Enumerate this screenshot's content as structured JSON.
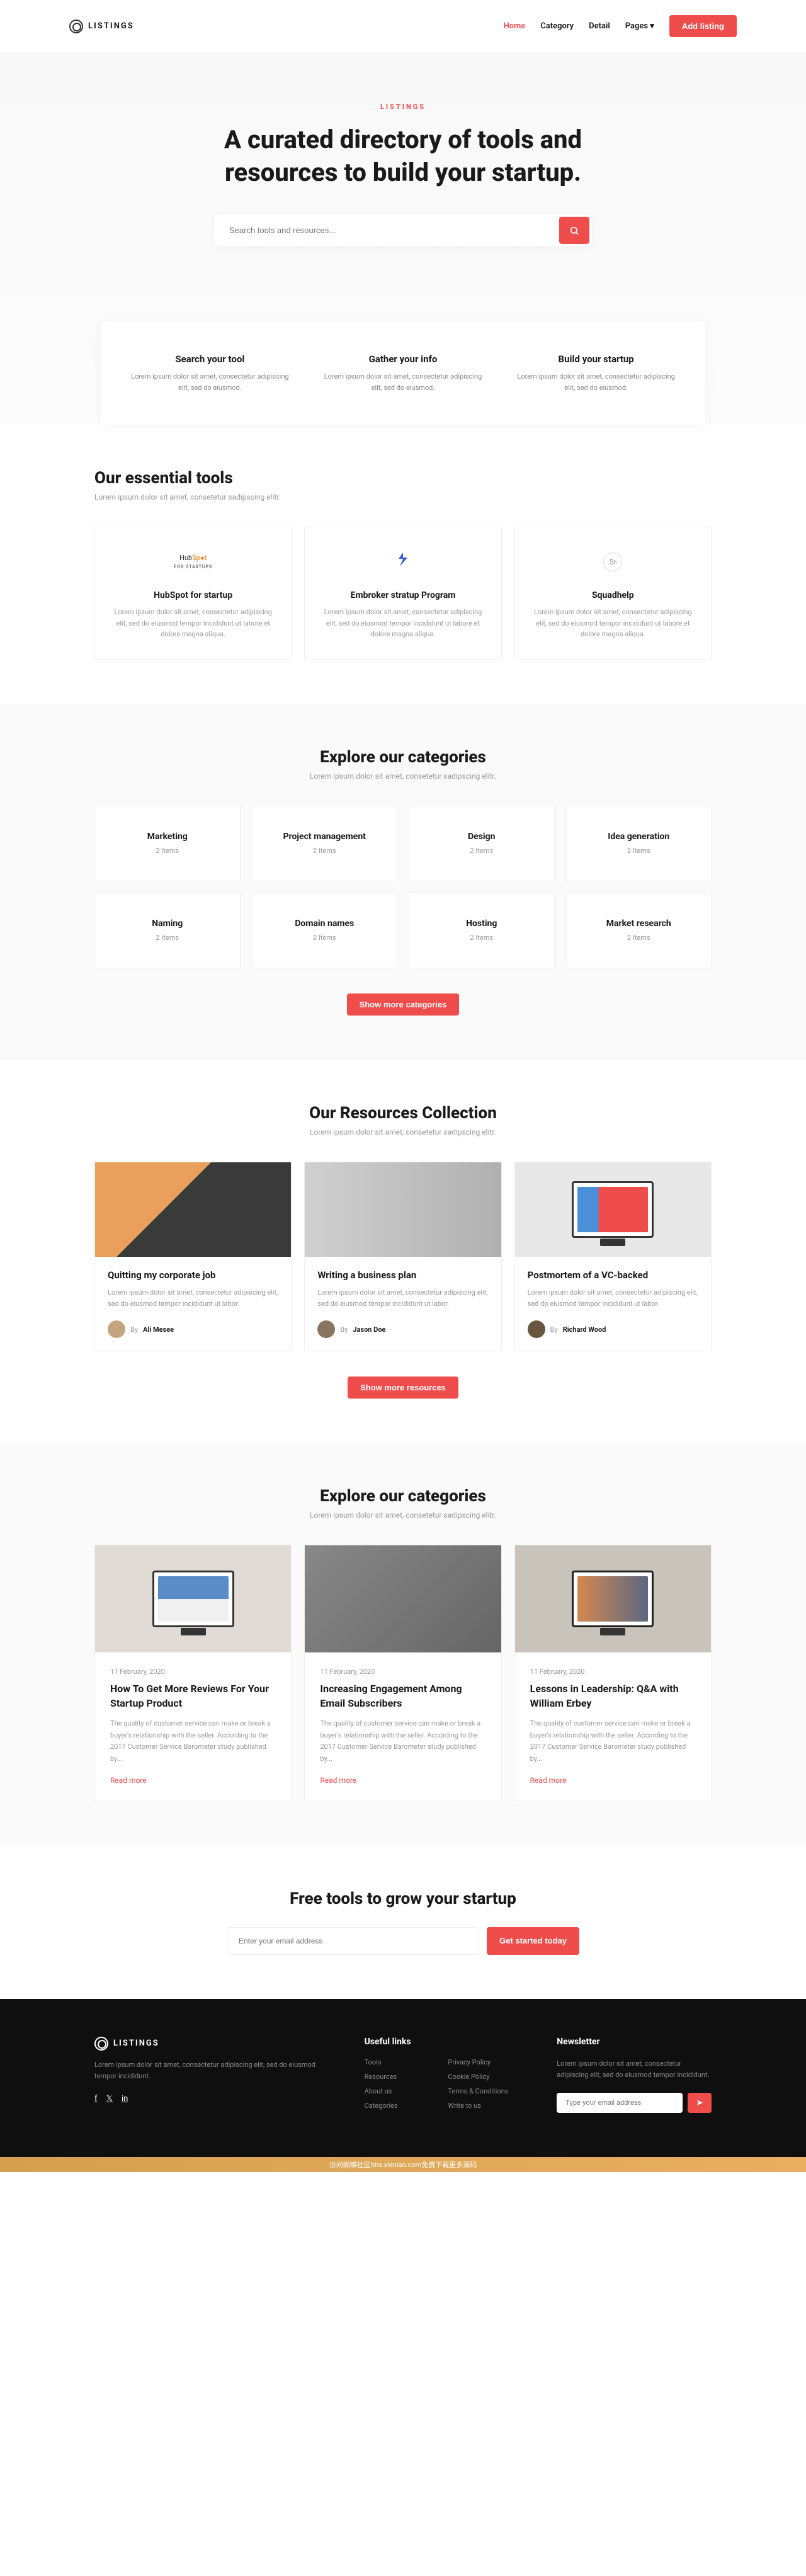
{
  "brand": "LISTINGS",
  "nav": {
    "home": "Home",
    "category": "Category",
    "detail": "Detail",
    "pages": "Pages",
    "add": "Add listing"
  },
  "hero": {
    "label": "LISTINGS",
    "title": "A curated directory of tools and resources to build your startup.",
    "placeholder": "Search tools and resources..."
  },
  "features": [
    {
      "title": "Search your tool",
      "desc": "Lorem ipsum dolor sit amet, consectetur adipiscing elit, sed do eiusmod."
    },
    {
      "title": "Gather your info",
      "desc": "Lorem ipsum dolor sit amet, consectetur adipiscing elit, sed do eiusmod."
    },
    {
      "title": "Build your startup",
      "desc": "Lorem ipsum dolor sit amet, consectetur adipiscing elit, sed do eiusmod."
    }
  ],
  "tools": {
    "title": "Our essential tools",
    "sub": "Lorem ipsum dolor sit amet, consetetur sadipscing elitr.",
    "items": [
      {
        "name": "HubSpot for startup",
        "desc": "Lorem ipsum dolor sit amet, consectetur adipiscing elit, sed do eiusmod tempor incididunt ut labore et dolore magna aliqua."
      },
      {
        "name": "Embroker stratup Program",
        "desc": "Lorem ipsum dolor sit amet, consectetur adipiscing elit, sed do eiusmod tempor incididunt ut labore et dolore magna aliqua."
      },
      {
        "name": "Squadhelp",
        "desc": "Lorem ipsum dolor sit amet, consectetur adipiscing elit, sed do eiusmod tempor incididunt ut labore et dolore magna aliqua."
      }
    ]
  },
  "categories": {
    "title": "Explore our categories",
    "sub": "Lorem ipsum dolor sit amet, consetetur sadipscing elitr.",
    "items": [
      {
        "name": "Marketing",
        "count": "2 Items"
      },
      {
        "name": "Project management",
        "count": "2 Items"
      },
      {
        "name": "Design",
        "count": "2 Items"
      },
      {
        "name": "Idea generation",
        "count": "2 Items"
      },
      {
        "name": "Naming",
        "count": "2 Items"
      },
      {
        "name": "Domain names",
        "count": "2 Items"
      },
      {
        "name": "Hosting",
        "count": "2 Items"
      },
      {
        "name": "Market research",
        "count": "2 Items"
      }
    ],
    "more": "Show more categories"
  },
  "resources": {
    "title": "Our Resources Collection",
    "sub": "Lorem ipsum dolor sit amet, consetetur sadipscing elitr.",
    "items": [
      {
        "title": "Quitting my corporate job",
        "desc": "Lorem ipsum dolor sit amet, consectetur adipiscing elit, sed do eiusmod tempor incididunt ut labor.",
        "by": "By",
        "author": "Ali Mesee"
      },
      {
        "title": "Writing a business plan",
        "desc": "Lorem ipsum dolor sit amet, consectetur adipiscing elit, sed do eiusmod tempor incididunt ut labor.",
        "by": "By",
        "author": "Jason Doe"
      },
      {
        "title": "Postmortem of a VC-backed",
        "desc": "Lorem ipsum dolor sit amet, consectetur adipiscing elit, sed do eiusmod tempor incididunt ut labor.",
        "by": "By",
        "author": "Richard Wood"
      }
    ],
    "more": "Show more resources"
  },
  "blogs": {
    "title": "Explore our categories",
    "sub": "Lorem ipsum dolor sit amet, consetetur sadipscing elitr.",
    "items": [
      {
        "date": "11 February, 2020",
        "title": "How To Get More Reviews For Your Startup Product",
        "desc": "The quality of customer service can make or break a buyer's relationship with the seller. According to the 2017 Customer Service Barometer study published by...",
        "more": "Read more"
      },
      {
        "date": "11 February, 2020",
        "title": "Increasing Engagement Among Email Subscribers",
        "desc": "The quality of customer service can make or break a buyer's relationship with the seller. According to the 2017 Customer Service Barometer study published by...",
        "more": "Read more"
      },
      {
        "date": "11 February, 2020",
        "title": "Lessons in Leadership: Q&A with William Erbey",
        "desc": "The quality of customer service can make or break a buyer's relationship with the seller. According to the 2017 Customer Service Barometer study published by...",
        "more": "Read more"
      }
    ]
  },
  "cta": {
    "title": "Free tools to grow your startup",
    "placeholder": "Enter your email address",
    "btn": "Get started today"
  },
  "footer": {
    "desc": "Lorem ipsum dolor sit amet, consectetur adipiscing elit, sed do eiusmod tempor incididunt.",
    "linksTitle": "Useful links",
    "links": [
      "Tools",
      "Privacy Policy",
      "Resources",
      "Cookie Policy",
      "About us",
      "Terms & Conditions",
      "Categories",
      "Write to us"
    ],
    "newsTitle": "Newsletter",
    "newsDesc": "Lorem ipsum dolor sit amet, consectetur adipiscing elit, sed do eiusmod tempor incididunt.",
    "newsPlaceholder": "Type your email address"
  },
  "banner": "访问蝴蝶社区bbs.xieniao.com免费下载更多源码"
}
